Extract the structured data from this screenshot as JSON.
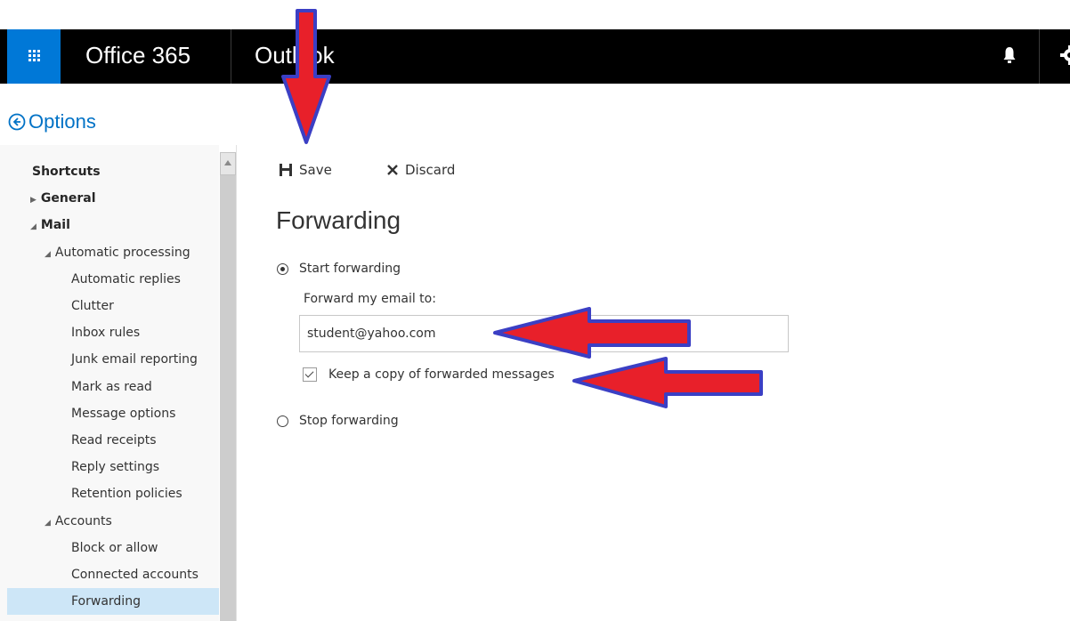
{
  "topbar": {
    "suite_title": "Office 365",
    "app_title": "Outlook",
    "accent": "#0078d7",
    "icons": [
      "app-launcher-icon",
      "bell-icon",
      "gear-icon"
    ]
  },
  "options_header": {
    "label": "Options",
    "icon": "back-circle-icon"
  },
  "nav": {
    "items": [
      {
        "label": "Shortcuts",
        "level": 0,
        "bold": true,
        "caret": ""
      },
      {
        "label": "General",
        "level": 0,
        "bold": true,
        "caret": "collapsed"
      },
      {
        "label": "Mail",
        "level": 0,
        "bold": true,
        "caret": "expanded"
      },
      {
        "label": "Automatic processing",
        "level": 1,
        "bold": false,
        "caret": "expanded"
      },
      {
        "label": "Automatic replies",
        "level": 2,
        "bold": false,
        "caret": ""
      },
      {
        "label": "Clutter",
        "level": 2,
        "bold": false,
        "caret": ""
      },
      {
        "label": "Inbox rules",
        "level": 2,
        "bold": false,
        "caret": ""
      },
      {
        "label": "Junk email reporting",
        "level": 2,
        "bold": false,
        "caret": ""
      },
      {
        "label": "Mark as read",
        "level": 2,
        "bold": false,
        "caret": ""
      },
      {
        "label": "Message options",
        "level": 2,
        "bold": false,
        "caret": ""
      },
      {
        "label": "Read receipts",
        "level": 2,
        "bold": false,
        "caret": ""
      },
      {
        "label": "Reply settings",
        "level": 2,
        "bold": false,
        "caret": ""
      },
      {
        "label": "Retention policies",
        "level": 2,
        "bold": false,
        "caret": ""
      },
      {
        "label": "Accounts",
        "level": 1,
        "bold": false,
        "caret": "expanded"
      },
      {
        "label": "Block or allow",
        "level": 2,
        "bold": false,
        "caret": ""
      },
      {
        "label": "Connected accounts",
        "level": 2,
        "bold": false,
        "caret": ""
      },
      {
        "label": "Forwarding",
        "level": 2,
        "bold": false,
        "caret": "",
        "selected": true
      }
    ],
    "selected_color": "#cde6f7"
  },
  "toolbar": {
    "save_label": "Save",
    "discard_label": "Discard"
  },
  "main": {
    "title": "Forwarding",
    "start_forwarding_label": "Start forwarding",
    "start_forwarding_checked": true,
    "forward_to_label": "Forward my email to:",
    "forward_to_value": "student@yahoo.com",
    "keep_copy_label": "Keep a copy of forwarded messages",
    "keep_copy_checked": true,
    "stop_forwarding_label": "Stop forwarding",
    "stop_forwarding_checked": false
  },
  "annotations": {
    "arrow_fill": "#e8202a",
    "arrow_stroke": "#3b3fc4"
  }
}
